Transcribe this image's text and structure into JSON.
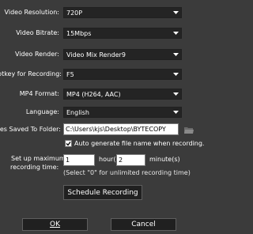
{
  "settings": {
    "resolution": {
      "label": "Video Resolution:",
      "value": "720P"
    },
    "bitrate": {
      "label": "Video Bitrate:",
      "value": "15Mbps"
    },
    "render": {
      "label": "Video Render:",
      "value": "Video Mix Render9"
    },
    "hotkey": {
      "label": "otkey for Recording:",
      "value": "F5"
    },
    "mp4_format": {
      "label": "MP4 Format:",
      "value": "MP4 (H264, AAC)"
    },
    "language": {
      "label": "Language:",
      "value": "English"
    },
    "folder": {
      "label": "les Saved To Folder:",
      "value": "C:\\Users\\kjs\\Desktop\\BYTECOPY"
    },
    "auto_name": {
      "label": "Auto generate file name when recording.",
      "checked": true
    },
    "max_time": {
      "label_line1": "Set up maximum",
      "label_line2": "recording time:",
      "hours_value": "1",
      "hours_label": "hour(s)",
      "minutes_value": "2",
      "minutes_label": "minute(s)",
      "hint": "(Select \"0\" for unlimited recording time)"
    }
  },
  "buttons": {
    "schedule": "Schedule Recording",
    "ok": "OK",
    "cancel": "Cancel"
  }
}
